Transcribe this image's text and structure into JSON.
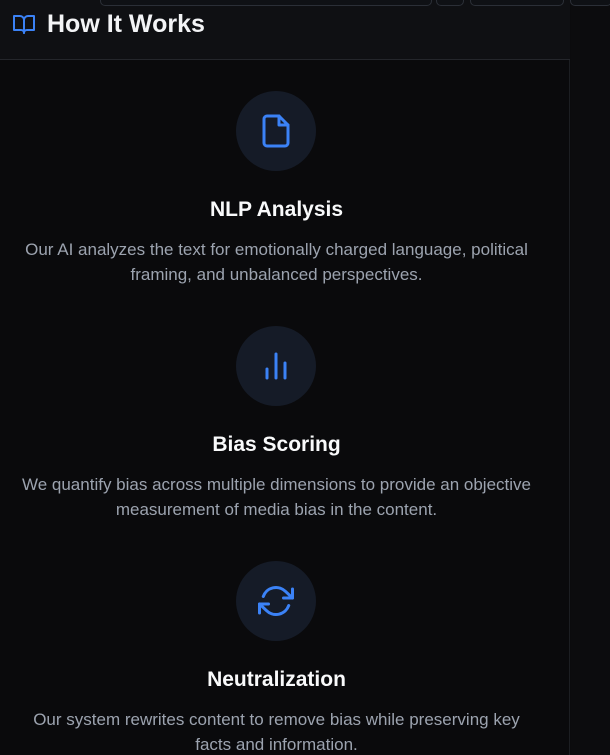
{
  "header": {
    "title": "How It Works",
    "icon": "open-book-icon"
  },
  "steps": [
    {
      "icon": "document-icon",
      "title": "NLP Analysis",
      "description_lines": [
        "Our AI analyzes the text for emotionally charged language, political",
        "framing, and unbalanced perspectives."
      ]
    },
    {
      "icon": "bar-chart-icon",
      "title": "Bias Scoring",
      "description_lines": [
        "We quantify bias across multiple dimensions to provide an objective",
        "measurement of media bias in the content."
      ]
    },
    {
      "icon": "refresh-icon",
      "title": "Neutralization",
      "description_lines": [
        "Our system rewrites content to remove bias while preserving key",
        "facts and information."
      ]
    }
  ],
  "colors": {
    "background": "#0a0a0c",
    "header_background": "#0f1013",
    "accent": "#3b82f6",
    "icon_badge": "#151b27",
    "title_text": "#f9fafb",
    "description_text": "#9ca3af"
  }
}
